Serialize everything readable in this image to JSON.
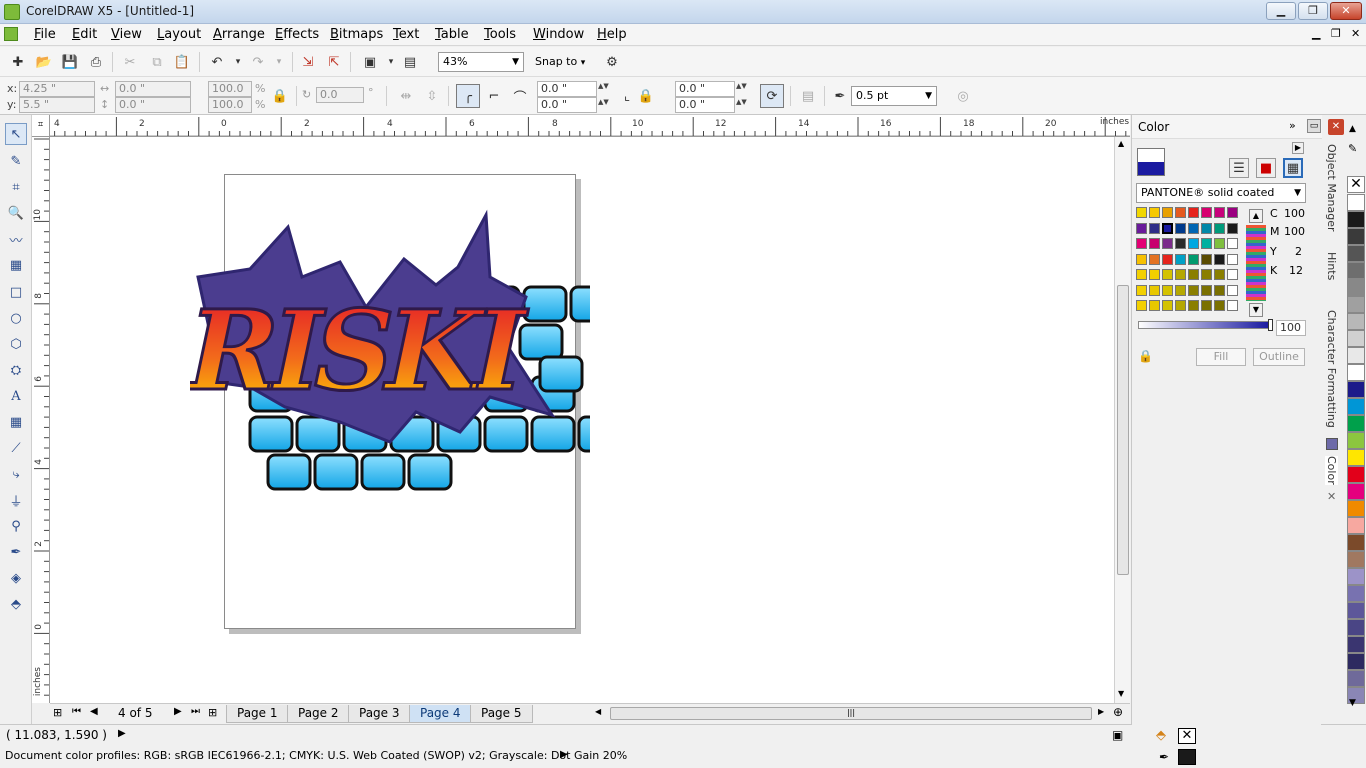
{
  "window": {
    "title": "CorelDRAW X5 - [Untitled-1]",
    "min_label": "▁",
    "max_label": "❐",
    "close_label": "✕"
  },
  "menubar": {
    "items": [
      {
        "key": "F",
        "rest": "ile"
      },
      {
        "key": "E",
        "rest": "dit"
      },
      {
        "key": "V",
        "rest": "iew"
      },
      {
        "key": "L",
        "rest": "ayout"
      },
      {
        "key": "A",
        "rest": "rrange"
      },
      {
        "key": "E",
        "rest": "ffects"
      },
      {
        "key": "B",
        "rest": "itmaps"
      },
      {
        "key": "T",
        "rest": "ext"
      },
      {
        "key": "T",
        "rest": "able"
      },
      {
        "key": "T",
        "rest": "ools"
      },
      {
        "key": "W",
        "rest": "indow"
      },
      {
        "key": "H",
        "rest": "elp"
      }
    ]
  },
  "standard": {
    "zoom": "43%",
    "snap_to": "Snap to"
  },
  "properties": {
    "x_label": "x:",
    "y_label": "y:",
    "x_value": "4.25 \"",
    "y_value": "5.5 \"",
    "w_value": "0.0 \"",
    "h_value": "0.0 \"",
    "scale_x": "100.0",
    "scale_y": "100.0",
    "percent": "%",
    "rotation": "0.0",
    "degree": "°",
    "corner_a1": "0.0 \"",
    "corner_a2": "0.0 \"",
    "corner_b1": "0.0 \"",
    "corner_b2": "0.0 \"",
    "outline_width": "0.5 pt"
  },
  "ruler": {
    "units": "inches",
    "h_ticks": [
      "4",
      "2",
      "0",
      "2",
      "4",
      "6",
      "8",
      "10",
      "12",
      "14",
      "16",
      "18",
      "20"
    ],
    "v_ticks": [
      "10",
      "8",
      "6",
      "4",
      "2",
      "0"
    ]
  },
  "pagenav": {
    "counter": "4 of 5",
    "pages": [
      "Page 1",
      "Page 2",
      "Page 3",
      "Page 4",
      "Page 5"
    ],
    "active_index": 3
  },
  "status": {
    "coords": "( 11.083, 1.590 )",
    "profiles": "Document color profiles: RGB: sRGB IEC61966-2.1; CMYK: U.S. Web Coated (SWOP) v2; Grayscale: Dot Gain 20%"
  },
  "artwork": {
    "text": "RISKI"
  },
  "docker": {
    "title": "Color",
    "palette_name": "PANTONE® solid coated",
    "cmyk": [
      {
        "label": "C",
        "value": "100"
      },
      {
        "label": "M",
        "value": "100"
      },
      {
        "label": "Y",
        "value": "2"
      },
      {
        "label": "K",
        "value": "12"
      }
    ],
    "tint": "100",
    "fill_button": "Fill",
    "outline_button": "Outline",
    "current_color": "#1a1aa0"
  },
  "docker_tabs": [
    "Object Manager",
    "Hints",
    "Character Formatting",
    "Color"
  ],
  "swatch_grid": [
    [
      "#f2d700",
      "#f6c800",
      "#e8a000",
      "#e55a1f",
      "#e5231c",
      "#d7006f",
      "#c8007b",
      "#9b0080"
    ],
    [
      "#6a1b9a",
      "#2e2d88",
      "#1a1aa0",
      "#003a8c",
      "#0066b3",
      "#0088a8",
      "#009a7a",
      "#1a1a1a"
    ],
    [
      "#e30074",
      "#c8006e",
      "#7b2b8a",
      "#2a2a2a",
      "#00a8e1",
      "#00b0a0",
      "#7fbf3f",
      "#ffffff"
    ],
    [
      "#f6c000",
      "#e37222",
      "#e5231c",
      "#00a0c6",
      "#009a6e",
      "#5a4b00",
      "#1a1a1a",
      "#ffffff"
    ],
    [
      "#f2d000",
      "#f2d000",
      "#d4c200",
      "#b5a800",
      "#8a7f00",
      "#8a7f00",
      "#8a7f00",
      "#ffffff"
    ],
    [
      "#f2d000",
      "#e8c800",
      "#d4c200",
      "#b5a800",
      "#8a7f00",
      "#7a7000",
      "#7a7000",
      "#ffffff"
    ],
    [
      "#f2d000",
      "#e8c800",
      "#d4c200",
      "#b5a800",
      "#8a7f00",
      "#7a7000",
      "#7a7000",
      "#ffffff"
    ]
  ],
  "right_palette": [
    "#ffffff",
    "#1a1a1a",
    "#3a3a3a",
    "#555555",
    "#6e6e6e",
    "#888888",
    "#a0a0a0",
    "#b8b8b8",
    "#d0d0d0",
    "#e8e8e8",
    "#ffffff",
    "#1c1a8a",
    "#0096d6",
    "#00a04b",
    "#8cc63f",
    "#ffe600",
    "#e2001a",
    "#e5007e",
    "#f08a00",
    "#f7a8a0",
    "#7b4a2a",
    "#a07860",
    "#9c93c8",
    "#7872b0",
    "#5d579a",
    "#4a4585",
    "#3a3570",
    "#2d2a60",
    "#6f6a9a",
    "#8a86b5"
  ]
}
